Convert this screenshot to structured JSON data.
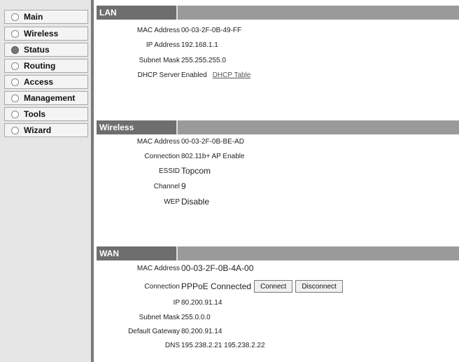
{
  "nav": {
    "items": [
      {
        "label": "Main",
        "active": false
      },
      {
        "label": "Wireless",
        "active": false
      },
      {
        "label": "Status",
        "active": true
      },
      {
        "label": "Routing",
        "active": false
      },
      {
        "label": "Access",
        "active": false
      },
      {
        "label": "Management",
        "active": false
      },
      {
        "label": "Tools",
        "active": false
      },
      {
        "label": "Wizard",
        "active": false
      }
    ]
  },
  "lan": {
    "title": "LAN",
    "mac_label": "MAC Address",
    "mac": "00-03-2F-0B-49-FF",
    "ip_label": "IP Address",
    "ip": "192.168.1.1",
    "mask_label": "Subnet Mask",
    "mask": "255.255.255.0",
    "dhcp_label": "DHCP Server",
    "dhcp": "Enabled",
    "dhcp_link": "DHCP Table"
  },
  "wireless": {
    "title": "Wireless",
    "mac_label": "MAC Address",
    "mac": "00-03-2F-0B-BE-AD",
    "conn_label": "Connection",
    "conn": "802.11b+ AP Enable",
    "essid_label": "ESSID",
    "essid": "Topcom",
    "channel_label": "Channel",
    "channel": "9",
    "wep_label": "WEP",
    "wep": "Disable"
  },
  "wan": {
    "title": "WAN",
    "mac_label": "MAC Address",
    "mac": "00-03-2F-0B-4A-00",
    "conn_label": "Connection",
    "conn": "PPPoE Connected",
    "connect_btn": "Connect",
    "disconnect_btn": "Disconnect",
    "ip_label": "IP",
    "ip": "80.200.91.14",
    "mask_label": "Subnet Mask",
    "mask": "255.0.0.0",
    "gw_label": "Default Gateway",
    "gw": "80.200.91.14",
    "dns_label": "DNS",
    "dns": "195.238.2.21 195.238.2.22"
  }
}
